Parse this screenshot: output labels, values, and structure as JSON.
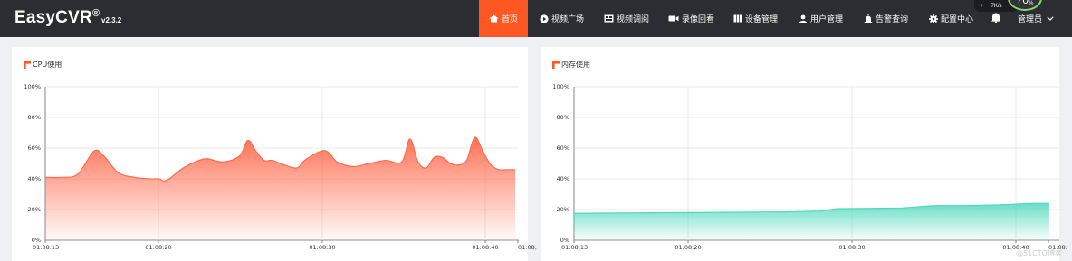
{
  "app": {
    "brand": "EasyCVR",
    "brand_mark": "®",
    "version": "v2.3.2"
  },
  "nav": {
    "items": [
      {
        "label": "首页",
        "icon": "home-icon",
        "active": true
      },
      {
        "label": "视频广场",
        "icon": "play-circle-icon",
        "active": false
      },
      {
        "label": "视频调阅",
        "icon": "video-grid-icon",
        "active": false
      },
      {
        "label": "录像回看",
        "icon": "video-camera-icon",
        "active": false
      },
      {
        "label": "设备管理",
        "icon": "device-icon",
        "active": false
      },
      {
        "label": "用户管理",
        "icon": "user-icon",
        "active": false
      },
      {
        "label": "告警查询",
        "icon": "alarm-icon",
        "active": false
      },
      {
        "label": "配置中心",
        "icon": "gear-icon",
        "active": false
      }
    ],
    "notifications_icon": "bell-icon",
    "user": "管理员",
    "user_caret_icon": "chevron-down-icon"
  },
  "net_widget": {
    "up_speed": "7",
    "up_unit": "K/s",
    "gauge_value": "70",
    "gauge_unit": "%"
  },
  "charts": {
    "cpu": {
      "title": "CPU使用",
      "icon": "chart-icon"
    },
    "memory": {
      "title": "内存使用",
      "icon": "chart-icon"
    }
  },
  "chart_data": [
    {
      "type": "area",
      "title": "CPU使用",
      "x_tick_labels": [
        "01:08:13",
        "01:08:20",
        "01:08:30",
        "01:08:40",
        "01:08:"
      ],
      "y_tick_labels": [
        "0%",
        "20%",
        "40%",
        "60%",
        "80%",
        "100%"
      ],
      "ylim": [
        0,
        100
      ],
      "grid": true,
      "series": [
        {
          "color": "#ff6a4d",
          "x_seconds": [
            0,
            1,
            2,
            3,
            3.6,
            4.5,
            5.5,
            6.5,
            7,
            7.5,
            8.5,
            9.5,
            10,
            11,
            12,
            12.5,
            13,
            13.5,
            14,
            14.5,
            15.5,
            16,
            17,
            17.5,
            18,
            19,
            20,
            21,
            22,
            22.5,
            23,
            23.5,
            24,
            24.5,
            25,
            25.5,
            26,
            26.5,
            27,
            27.5,
            28,
            28.5,
            29
          ],
          "values": [
            41,
            41,
            43,
            58,
            55,
            44,
            41,
            40,
            40,
            39,
            47,
            52,
            53,
            51,
            55,
            65,
            58,
            52,
            52,
            50,
            47,
            52,
            58,
            57,
            51,
            48,
            50,
            52,
            51,
            66,
            51,
            47,
            54,
            54,
            50,
            49,
            52,
            67,
            58,
            49,
            46,
            46,
            46
          ]
        }
      ]
    },
    {
      "type": "area",
      "title": "内存使用",
      "x_tick_labels": [
        "01:08:13",
        "01:08:20",
        "01:08:30",
        "01:08:40",
        "01:08:"
      ],
      "y_tick_labels": [
        "0%",
        "20%",
        "40%",
        "60%",
        "80%",
        "100%"
      ],
      "ylim": [
        0,
        100
      ],
      "grid": true,
      "series": [
        {
          "color": "#4fd8bd",
          "x_seconds": [
            0,
            7,
            13,
            15,
            16,
            20,
            22,
            24,
            26,
            28,
            29
          ],
          "values": [
            17.5,
            18,
            18.5,
            19,
            20.5,
            21,
            22.5,
            22.5,
            23,
            24,
            24
          ]
        }
      ]
    }
  ],
  "watermark": "@51CTO博客"
}
